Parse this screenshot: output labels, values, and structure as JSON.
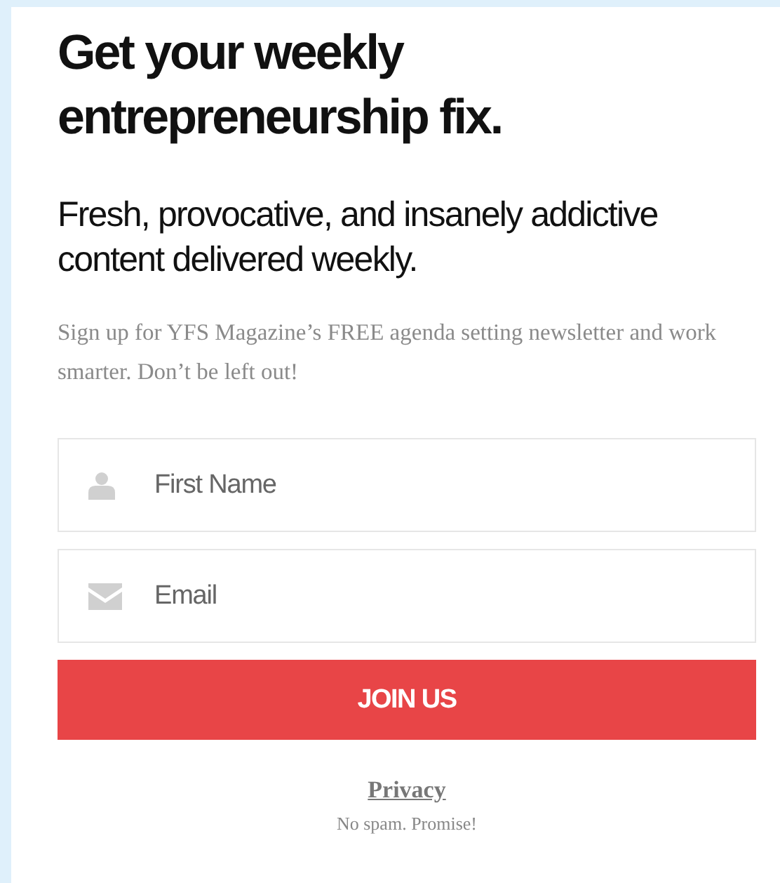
{
  "headline": "Get your weekly entrepreneurship fix.",
  "subheadline": "Fresh, provocative, and insanely addictive content delivered weekly.",
  "intro": "Sign up for YFS Magazine’s FREE agenda setting newsletter and work smarter. Don’t be left out!",
  "fields": [
    {
      "kind": "person",
      "placeholder": "First Name"
    },
    {
      "kind": "mail",
      "placeholder": "Email"
    }
  ],
  "submit": "JOIN US",
  "privacy_link": "Privacy",
  "note": "No spam. Promise!"
}
